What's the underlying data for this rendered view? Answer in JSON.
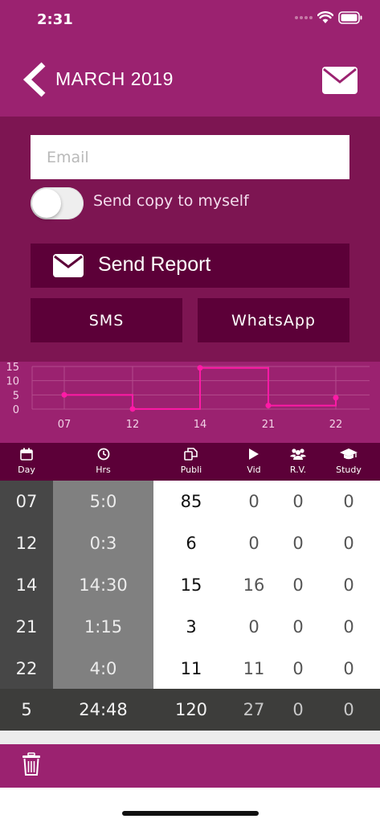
{
  "status_bar": {
    "time": "2:31"
  },
  "header": {
    "title": "MARCH 2019"
  },
  "form": {
    "email_placeholder": "Email",
    "email_value": "",
    "copy_label": "Send copy to myself",
    "copy_enabled": false,
    "send_report_label": "Send Report",
    "sms_label": "SMS",
    "whatsapp_label": "WhatsApp"
  },
  "colors": {
    "primary": "#9b2270",
    "dark": "#5c0038",
    "form_bg": "#7d1552",
    "line": "#ff1aa6"
  },
  "chart_data": {
    "type": "line",
    "step": true,
    "categories": [
      "07",
      "12",
      "14",
      "21",
      "22"
    ],
    "values": [
      5,
      0.05,
      14.5,
      1.25,
      4
    ],
    "ylim": [
      0,
      15
    ],
    "yticks": [
      0,
      5,
      10,
      15
    ],
    "grid": true
  },
  "columns": [
    {
      "label": "Day",
      "icon": "calendar-icon"
    },
    {
      "label": "Hrs",
      "icon": "clock-icon"
    },
    {
      "label": "Publi",
      "icon": "copy-icon"
    },
    {
      "label": "Vid",
      "icon": "play-icon"
    },
    {
      "label": "R.V.",
      "icon": "people-icon"
    },
    {
      "label": "Study",
      "icon": "graduation-cap-icon"
    }
  ],
  "rows": [
    {
      "day": "07",
      "hrs": "5:0",
      "publi": "85",
      "vid": "0",
      "rv": "0",
      "study": "0"
    },
    {
      "day": "12",
      "hrs": "0:3",
      "publi": "6",
      "vid": "0",
      "rv": "0",
      "study": "0"
    },
    {
      "day": "14",
      "hrs": "14:30",
      "publi": "15",
      "vid": "16",
      "rv": "0",
      "study": "0"
    },
    {
      "day": "21",
      "hrs": "1:15",
      "publi": "3",
      "vid": "0",
      "rv": "0",
      "study": "0"
    },
    {
      "day": "22",
      "hrs": "4:0",
      "publi": "11",
      "vid": "11",
      "rv": "0",
      "study": "0"
    }
  ],
  "totals": {
    "day": "5",
    "hrs": "24:48",
    "publi": "120",
    "vid": "27",
    "rv": "0",
    "study": "0"
  }
}
